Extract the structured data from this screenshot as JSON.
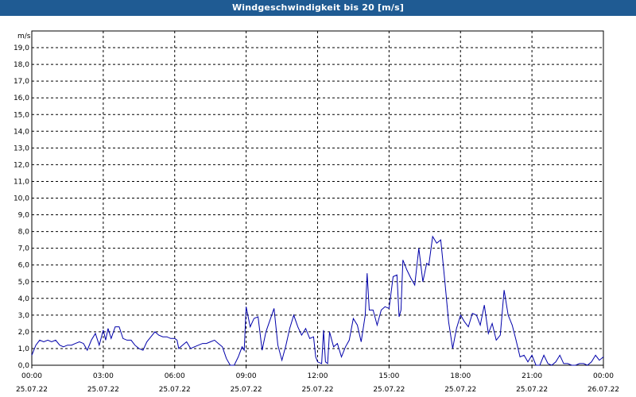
{
  "title": "Windgeschwindigkeit bis 20 [m/s]",
  "chart_data": {
    "type": "line",
    "title": "Windgeschwindigkeit bis 20 [m/s]",
    "ylabel": "m/s",
    "xlabel": "",
    "ylim": [
      0,
      20
    ],
    "xlim_hours": [
      0,
      24
    ],
    "grid": true,
    "line_color": "#0000aa",
    "y_ticks": [
      "0,0",
      "1,0",
      "2,0",
      "3,0",
      "4,0",
      "5,0",
      "6,0",
      "7,0",
      "8,0",
      "9,0",
      "10,0",
      "11,0",
      "12,0",
      "13,0",
      "14,0",
      "15,0",
      "16,0",
      "17,0",
      "18,0",
      "19,0"
    ],
    "x_ticks": [
      {
        "time": "00:00",
        "date": "25.07.22"
      },
      {
        "time": "03:00",
        "date": "25.07.22"
      },
      {
        "time": "06:00",
        "date": "25.07.22"
      },
      {
        "time": "09:00",
        "date": "25.07.22"
      },
      {
        "time": "12:00",
        "date": "25.07.22"
      },
      {
        "time": "15:00",
        "date": "25.07.22"
      },
      {
        "time": "18:00",
        "date": "25.07.22"
      },
      {
        "time": "21:00",
        "date": "25.07.22"
      },
      {
        "time": "00:00",
        "date": "26.07.22"
      }
    ],
    "series": [
      {
        "color": "#0000aa",
        "points": [
          [
            0.0,
            0.6
          ],
          [
            0.17,
            1.2
          ],
          [
            0.33,
            1.5
          ],
          [
            0.5,
            1.4
          ],
          [
            0.67,
            1.5
          ],
          [
            0.83,
            1.4
          ],
          [
            1.0,
            1.5
          ],
          [
            1.17,
            1.2
          ],
          [
            1.33,
            1.1
          ],
          [
            1.5,
            1.2
          ],
          [
            1.67,
            1.2
          ],
          [
            1.83,
            1.3
          ],
          [
            2.0,
            1.4
          ],
          [
            2.17,
            1.3
          ],
          [
            2.33,
            0.9
          ],
          [
            2.5,
            1.5
          ],
          [
            2.67,
            1.9
          ],
          [
            2.83,
            1.2
          ],
          [
            3.0,
            2.1
          ],
          [
            3.1,
            1.5
          ],
          [
            3.2,
            2.2
          ],
          [
            3.33,
            1.6
          ],
          [
            3.5,
            2.3
          ],
          [
            3.67,
            2.3
          ],
          [
            3.83,
            1.6
          ],
          [
            4.0,
            1.5
          ],
          [
            4.17,
            1.5
          ],
          [
            4.33,
            1.2
          ],
          [
            4.5,
            1.0
          ],
          [
            4.67,
            0.9
          ],
          [
            4.83,
            1.4
          ],
          [
            5.0,
            1.7
          ],
          [
            5.17,
            2.0
          ],
          [
            5.33,
            1.8
          ],
          [
            5.5,
            1.7
          ],
          [
            5.67,
            1.7
          ],
          [
            5.83,
            1.6
          ],
          [
            6.0,
            1.6
          ],
          [
            6.1,
            1.5
          ],
          [
            6.17,
            1.0
          ],
          [
            6.33,
            1.2
          ],
          [
            6.5,
            1.4
          ],
          [
            6.67,
            1.0
          ],
          [
            6.83,
            1.1
          ],
          [
            7.0,
            1.2
          ],
          [
            7.17,
            1.3
          ],
          [
            7.33,
            1.3
          ],
          [
            7.5,
            1.4
          ],
          [
            7.67,
            1.5
          ],
          [
            7.83,
            1.3
          ],
          [
            8.0,
            1.1
          ],
          [
            8.17,
            0.4
          ],
          [
            8.33,
            0.0
          ],
          [
            8.5,
            0.0
          ],
          [
            8.67,
            0.5
          ],
          [
            8.83,
            1.1
          ],
          [
            8.92,
            0.9
          ],
          [
            9.0,
            3.5
          ],
          [
            9.17,
            2.3
          ],
          [
            9.33,
            2.8
          ],
          [
            9.5,
            2.9
          ],
          [
            9.67,
            0.9
          ],
          [
            9.83,
            2.0
          ],
          [
            10.0,
            2.7
          ],
          [
            10.17,
            3.4
          ],
          [
            10.33,
            1.2
          ],
          [
            10.5,
            0.3
          ],
          [
            10.67,
            1.2
          ],
          [
            10.83,
            2.2
          ],
          [
            11.0,
            3.0
          ],
          [
            11.17,
            2.3
          ],
          [
            11.33,
            1.8
          ],
          [
            11.5,
            2.2
          ],
          [
            11.67,
            1.6
          ],
          [
            11.83,
            1.7
          ],
          [
            11.92,
            0.5
          ],
          [
            12.0,
            0.2
          ],
          [
            12.17,
            0.1
          ],
          [
            12.25,
            2.1
          ],
          [
            12.33,
            0.2
          ],
          [
            12.42,
            0.1
          ],
          [
            12.5,
            2.0
          ],
          [
            12.67,
            1.1
          ],
          [
            12.83,
            1.3
          ],
          [
            13.0,
            0.5
          ],
          [
            13.17,
            1.1
          ],
          [
            13.33,
            1.5
          ],
          [
            13.5,
            2.8
          ],
          [
            13.67,
            2.4
          ],
          [
            13.83,
            1.4
          ],
          [
            14.0,
            3.0
          ],
          [
            14.08,
            5.5
          ],
          [
            14.17,
            3.3
          ],
          [
            14.33,
            3.3
          ],
          [
            14.5,
            2.4
          ],
          [
            14.67,
            3.3
          ],
          [
            14.83,
            3.5
          ],
          [
            15.0,
            3.4
          ],
          [
            15.17,
            5.3
          ],
          [
            15.33,
            5.4
          ],
          [
            15.42,
            2.9
          ],
          [
            15.5,
            3.3
          ],
          [
            15.58,
            6.3
          ],
          [
            15.75,
            5.7
          ],
          [
            15.92,
            5.2
          ],
          [
            16.08,
            4.8
          ],
          [
            16.25,
            7.0
          ],
          [
            16.42,
            5.0
          ],
          [
            16.58,
            6.1
          ],
          [
            16.67,
            6.0
          ],
          [
            16.83,
            7.7
          ],
          [
            17.0,
            7.3
          ],
          [
            17.17,
            7.5
          ],
          [
            17.33,
            5.2
          ],
          [
            17.5,
            2.6
          ],
          [
            17.67,
            1.0
          ],
          [
            17.83,
            2.2
          ],
          [
            18.0,
            3.0
          ],
          [
            18.17,
            2.6
          ],
          [
            18.33,
            2.3
          ],
          [
            18.5,
            3.1
          ],
          [
            18.67,
            3.0
          ],
          [
            18.83,
            2.4
          ],
          [
            19.0,
            3.6
          ],
          [
            19.17,
            1.9
          ],
          [
            19.33,
            2.5
          ],
          [
            19.5,
            1.5
          ],
          [
            19.67,
            1.8
          ],
          [
            19.83,
            4.5
          ],
          [
            20.0,
            3.0
          ],
          [
            20.17,
            2.4
          ],
          [
            20.33,
            1.5
          ],
          [
            20.5,
            0.5
          ],
          [
            20.67,
            0.6
          ],
          [
            20.83,
            0.2
          ],
          [
            21.0,
            0.6
          ],
          [
            21.17,
            0.0
          ],
          [
            21.33,
            0.0
          ],
          [
            21.5,
            0.6
          ],
          [
            21.67,
            0.1
          ],
          [
            21.83,
            0.0
          ],
          [
            22.0,
            0.2
          ],
          [
            22.17,
            0.6
          ],
          [
            22.33,
            0.1
          ],
          [
            22.5,
            0.1
          ],
          [
            22.67,
            0.0
          ],
          [
            22.83,
            0.0
          ],
          [
            23.0,
            0.1
          ],
          [
            23.17,
            0.1
          ],
          [
            23.33,
            0.0
          ],
          [
            23.5,
            0.2
          ],
          [
            23.67,
            0.6
          ],
          [
            23.83,
            0.3
          ],
          [
            24.0,
            0.5
          ]
        ]
      }
    ]
  }
}
